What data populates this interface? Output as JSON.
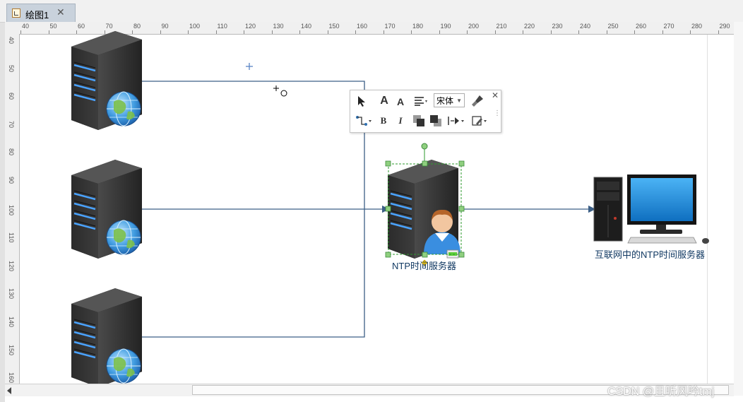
{
  "tab": {
    "title": "绘图1",
    "close_symbol": "✕"
  },
  "ruler": {
    "top_ticks": [
      "40",
      "50",
      "60",
      "70",
      "80",
      "90",
      "100",
      "110",
      "120",
      "130",
      "140",
      "150",
      "160",
      "170",
      "180",
      "190",
      "200",
      "210",
      "220",
      "230",
      "240",
      "250",
      "260",
      "270",
      "280",
      "290"
    ],
    "left_ticks": [
      "40",
      "50",
      "60",
      "70",
      "80",
      "90",
      "100",
      "110",
      "120",
      "130",
      "140",
      "150",
      "160"
    ]
  },
  "diagram": {
    "ntp_server_label": "NTP时间服务器",
    "internet_ntp_label": "互联网中的NTP时间服务器",
    "client_server_icon": "server-globe-icon",
    "ntp_server_icon": "server-user-icon",
    "internet_icon": "desktop-computer-icon"
  },
  "toolbar": {
    "font_name": "宋体",
    "bold": "B",
    "italic": "I",
    "font_grow": "A",
    "font_shrink": "A",
    "close": "✕"
  },
  "watermark": "CSDN @且听风吟tmj",
  "colors": {
    "connector": "#3c5f86",
    "selection": "#2e9a2e",
    "tab_bg": "#c9d2dc"
  }
}
